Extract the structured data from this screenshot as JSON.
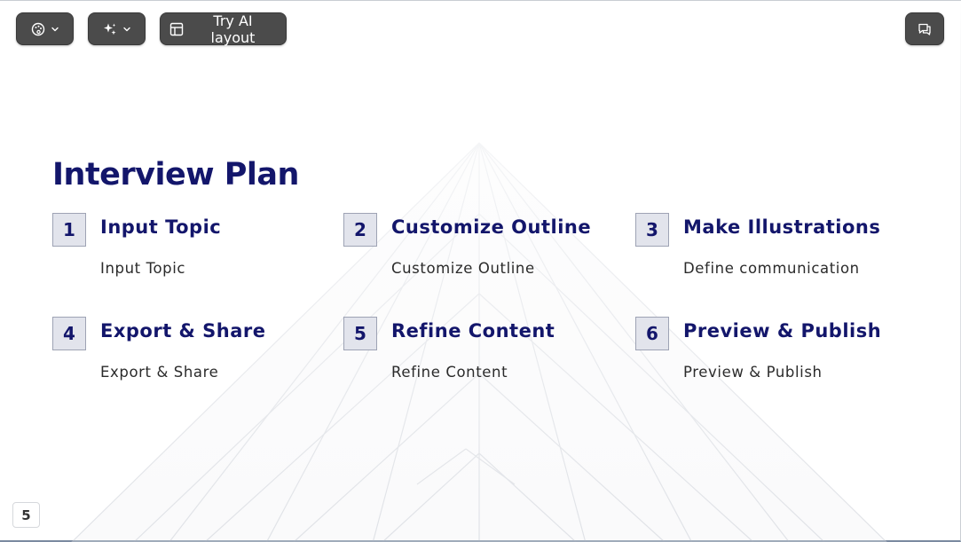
{
  "toolbar": {
    "theme_icon": "palette-icon",
    "ai_icon": "sparkle-icon",
    "layout_label": "Try AI layout",
    "layout_icon": "layout-icon",
    "comment_icon": "comment-icon"
  },
  "slide": {
    "title": "Interview Plan",
    "steps": [
      {
        "num": "1",
        "title": "Input Topic",
        "desc": "Input Topic"
      },
      {
        "num": "2",
        "title": "Customize Outline",
        "desc": "Customize Outline"
      },
      {
        "num": "3",
        "title": "Make Illustrations",
        "desc": "Define communication"
      },
      {
        "num": "4",
        "title": "Export & Share",
        "desc": "Export & Share"
      },
      {
        "num": "5",
        "title": "Refine Content",
        "desc": "Refine Content"
      },
      {
        "num": "6",
        "title": "Preview & Publish",
        "desc": "Preview & Publish"
      }
    ]
  },
  "page_number": "5",
  "colors": {
    "accent": "#13166b",
    "toolbar_bg": "#4b4b4b",
    "number_box_bg": "#e2e4ec"
  }
}
